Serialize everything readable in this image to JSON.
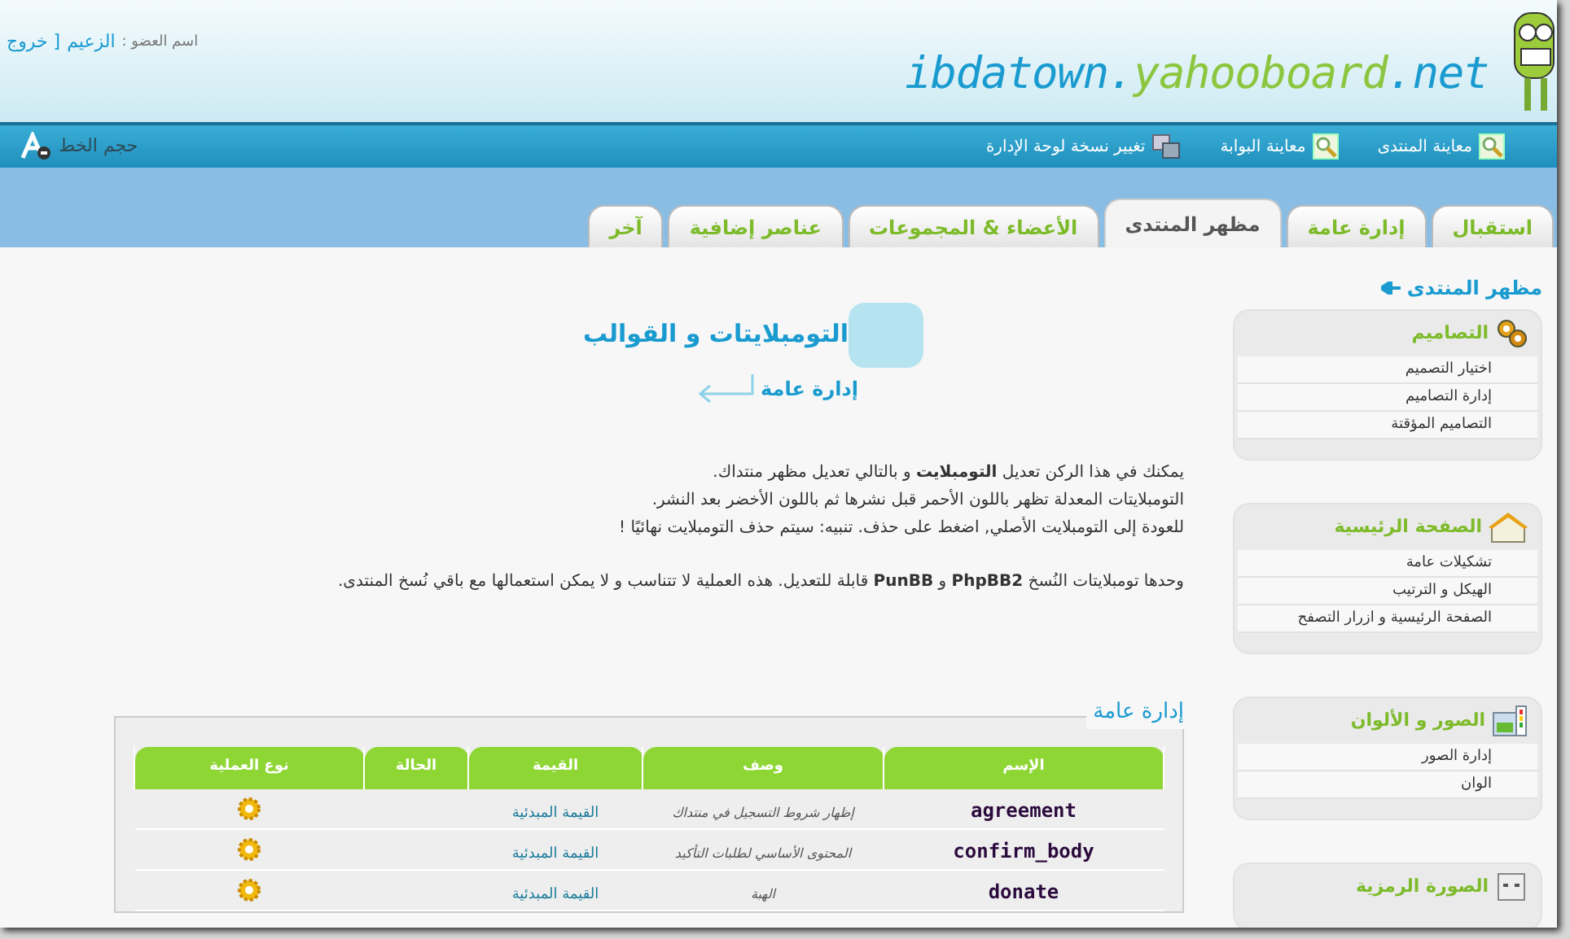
{
  "header": {
    "site_title_part1": "ibdatown.",
    "site_title_part2": "yahooboard",
    "site_title_part3": ".net",
    "user_label": "اسم العضو :",
    "username": "الزعيم",
    "logout": "[ خروج"
  },
  "toolbar": {
    "links": [
      {
        "label": "معاينة المنتدى",
        "kind": "search"
      },
      {
        "label": "معاينة البوابة",
        "kind": "search"
      },
      {
        "label": "تغيير نسخة لوحة الإدارة",
        "kind": "switch"
      }
    ],
    "font_size": "حجم الخط"
  },
  "tabs": [
    {
      "label": "استقبال",
      "selected": false
    },
    {
      "label": "إدارة عامة",
      "selected": false
    },
    {
      "label": "مظهر المنتدى",
      "selected": true
    },
    {
      "label": "الأعضاء & المجموعات",
      "selected": false
    },
    {
      "label": "عناصر إضافية",
      "selected": false
    },
    {
      "label": "آخر",
      "selected": false
    }
  ],
  "sidebar": {
    "heading": "مظهر المنتدى",
    "sections": [
      {
        "title": "التصاميم",
        "kind": "themes",
        "items": [
          "اختيار التصميم",
          "إدارة التصاميم",
          "التصاميم المؤقتة"
        ]
      },
      {
        "title": "الصفحة الرئيسية",
        "kind": "home",
        "items": [
          "تشكيلات عامة",
          "الهيكل و الترتيب",
          "الصفحة الرئيسية و ازرار التصفح"
        ]
      },
      {
        "title": "الصور و الألوان",
        "kind": "images",
        "items": [
          "إدارة الصور",
          "الوان"
        ]
      },
      {
        "title": "الصورة الرمزية",
        "kind": "avatar"
      }
    ]
  },
  "main": {
    "title": "التومبلايتات و القوالب",
    "subtitle": "إدارة عامة",
    "paragraphs": [
      [
        "يمكنك في هذا الركن تعديل **التومبلايت** و بالتالي تعديل مظهر منتداك.",
        "التومبلايتات المعدلة تظهر باللون الأحمر قبل نشرها ثم باللون الأخضر بعد النشر.",
        "للعودة إلى التومبلايت الأصلي, اضغط على حذف. تنبيه: سيتم حذف التومبلايت نهائيًا !"
      ],
      [
        "وحدها تومبلايتات النُسخ **PhpBB2** و **PunBB** قابلة للتعديل. هذه العملية لا تتناسب و لا يمكن استعمالها مع باقي نُسخ المنتدى."
      ]
    ]
  },
  "table": {
    "legend": "إدارة عامة",
    "columns": [
      "الإسم",
      "وصف",
      "القيمة",
      "الحالة",
      "نوع العملية"
    ],
    "rows": [
      {
        "name": "agreement",
        "description": "إظهار شروط التسجيل في منتداك",
        "value": "القيمة المبدئية"
      },
      {
        "name": "confirm_body",
        "description": "المحتوى الأساسي لطلبات التأكيد",
        "value": "القيمة المبدئية"
      },
      {
        "name": "donate",
        "description": "الهبة",
        "value": "القيمة المبدئية"
      }
    ]
  }
}
